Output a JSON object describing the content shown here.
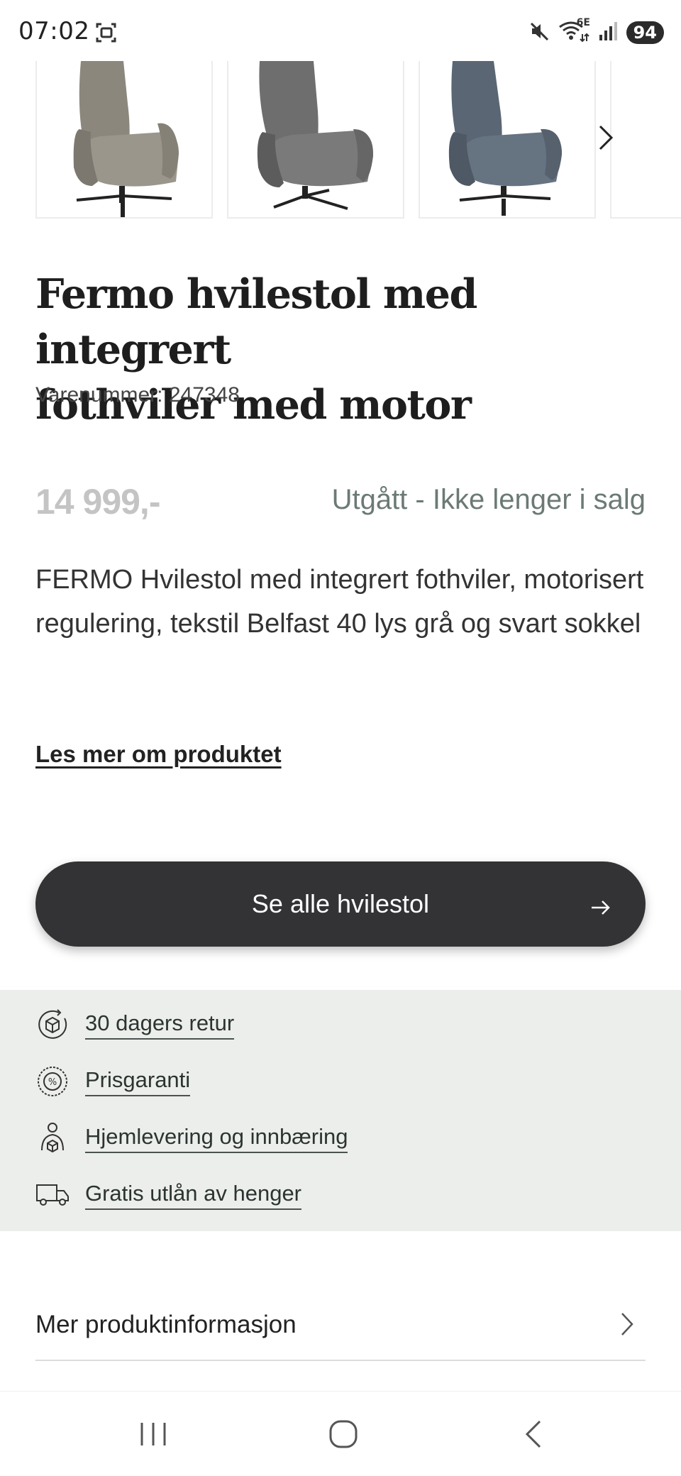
{
  "status_bar": {
    "time": "07:02",
    "network": "6E",
    "battery": "94",
    "icons": [
      "screenshot-icon",
      "mute-icon",
      "wifi-icon",
      "signal-icon",
      "battery-icon"
    ]
  },
  "carousel": {
    "thumbnails": [
      {
        "alt": "Hvilestol grå-beige",
        "color": "#8b877d"
      },
      {
        "alt": "Hvilestol saueskinn grå",
        "color": "#6e6e6e"
      },
      {
        "alt": "Hvilestol blå",
        "color": "#5a6673"
      }
    ],
    "next_icon": "chevron-right-icon"
  },
  "product": {
    "title_line1": "Fermo hvilestol med integrert",
    "title_line2": "fothviler med motor",
    "sku_label": "Varenummer:",
    "sku_value": "247348",
    "price": "14 999,-",
    "availability": "Utgått - Ikke lenger i salg",
    "description": "FERMO Hvilestol med integrert fothviler, motorisert regulering, tekstil Belfast 40 lys grå og svart sokkel",
    "read_more": "Les mer om produktet"
  },
  "cta": {
    "label": "Se alle hvilestol",
    "icon": "arrow-right-icon"
  },
  "usps": [
    {
      "label": "30 dagers retur",
      "icon": "return-box-icon"
    },
    {
      "label": "Prisgaranti",
      "icon": "price-guarantee-icon"
    },
    {
      "label": "Hjemlevering og innbæring",
      "icon": "delivery-person-icon"
    },
    {
      "label": "Gratis utlån av henger",
      "icon": "truck-icon"
    }
  ],
  "more_info": {
    "label": "Mer produktinformasjon",
    "icon": "chevron-right-icon"
  },
  "nav_bar": {
    "buttons": [
      "recent-apps-icon",
      "home-icon",
      "back-icon"
    ]
  },
  "colors": {
    "accent_dark": "#333336",
    "availability_text": "#6c7a74",
    "price_muted": "#c4c4c4",
    "usp_background": "#eceeeb"
  }
}
